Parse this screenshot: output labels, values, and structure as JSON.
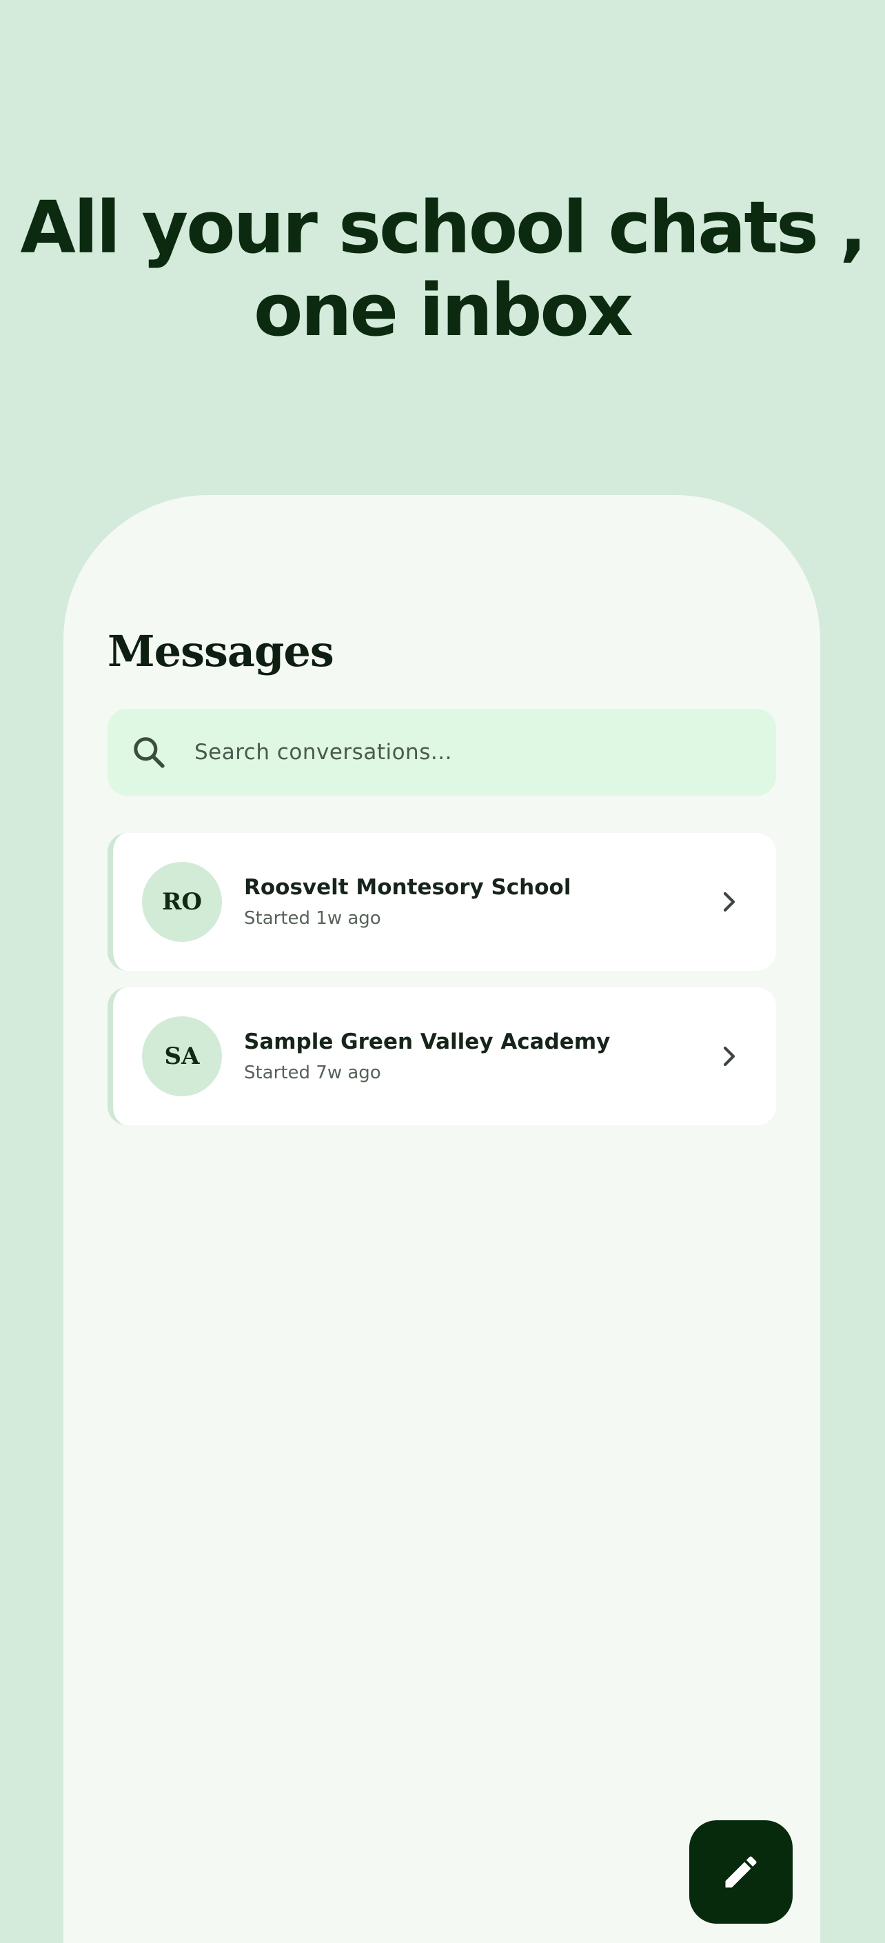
{
  "hero": {
    "line1": "All your school chats ,",
    "line2": "one inbox"
  },
  "messages": {
    "title": "Messages",
    "search_placeholder": "Search conversations...",
    "search_value": "",
    "conversations": [
      {
        "initials": "RO",
        "name": "Roosvelt Montesory School",
        "started": "Started 1w ago"
      },
      {
        "initials": "SA",
        "name": "Sample Green Valley Academy",
        "started": "Started 7w ago"
      }
    ]
  },
  "icons": {
    "search": "search-icon",
    "chevron": "chevron-right-icon",
    "compose": "pencil-icon"
  },
  "colors": {
    "background": "#d4eadb",
    "panel": "#f4f9f4",
    "search_bg": "#dff8e4",
    "accent_dark": "#072a0c",
    "avatar_bg": "#d2ebd7"
  }
}
